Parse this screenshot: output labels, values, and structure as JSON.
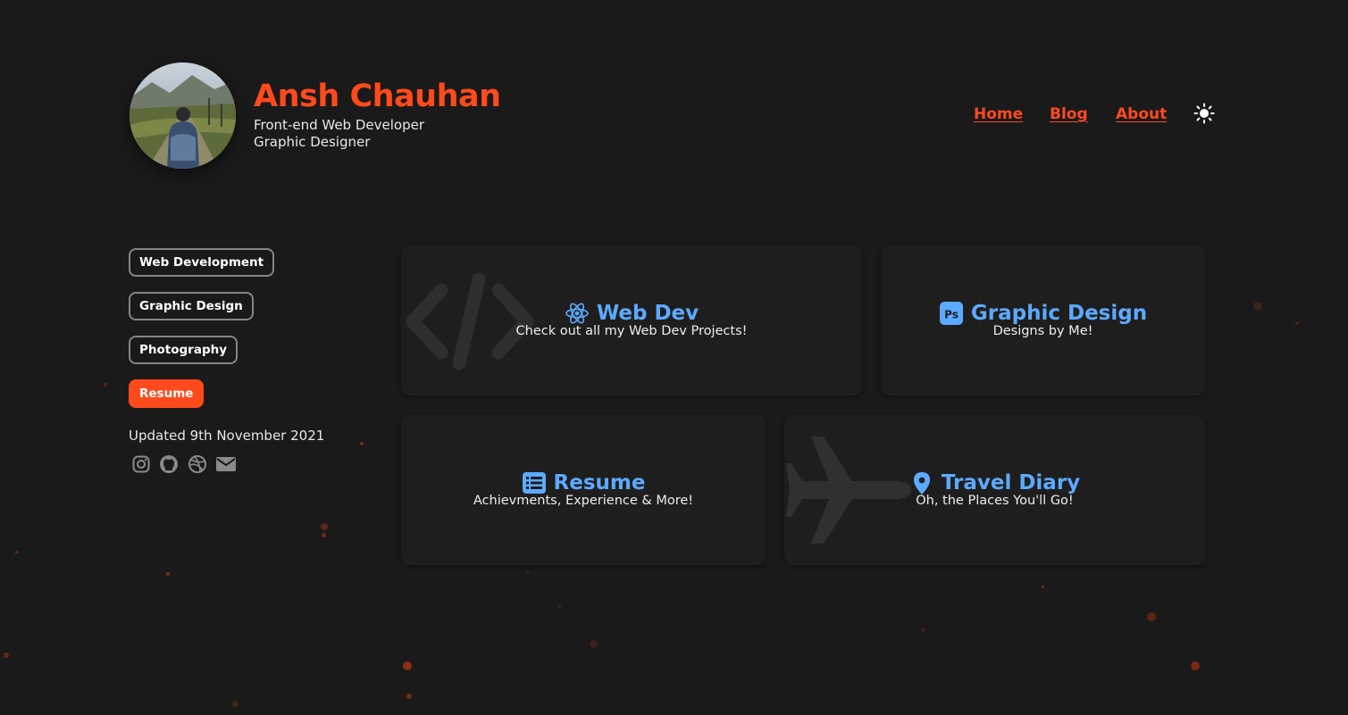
{
  "header": {
    "name": "Ansh Chauhan",
    "roles": [
      "Front-end Web Developer",
      "Graphic Designer"
    ]
  },
  "nav": {
    "items": [
      {
        "label": "Home"
      },
      {
        "label": "Blog"
      },
      {
        "label": "About"
      }
    ],
    "theme_icon": "sun-icon"
  },
  "sidebar": {
    "pills": [
      {
        "label": "Web Development",
        "active": false
      },
      {
        "label": "Graphic Design",
        "active": false
      },
      {
        "label": "Photography",
        "active": false
      },
      {
        "label": "Resume",
        "active": true
      }
    ],
    "updated": "Updated 9th November 2021",
    "social": [
      "instagram-icon",
      "github-icon",
      "dribbble-icon",
      "envelope-icon"
    ]
  },
  "cards": [
    {
      "title": "Web Dev",
      "subtitle": "Check out all my Web Dev Projects!",
      "icon": "react-icon",
      "bg_icon": "code-icon"
    },
    {
      "title": "Graphic Design",
      "subtitle": "Designs by Me!",
      "icon": "photoshop-icon"
    },
    {
      "title": "Resume",
      "subtitle": "Achievments, Experience & More!",
      "icon": "list-icon"
    },
    {
      "title": "Travel Diary",
      "subtitle": "Oh, the Places You'll Go!",
      "icon": "map-pin-icon",
      "bg_icon": "airplane-icon"
    }
  ],
  "colors": {
    "accent": "#ff4a1c",
    "card_title": "#5caaff",
    "background": "#1a1a1a",
    "card": "#1f1e1e"
  }
}
